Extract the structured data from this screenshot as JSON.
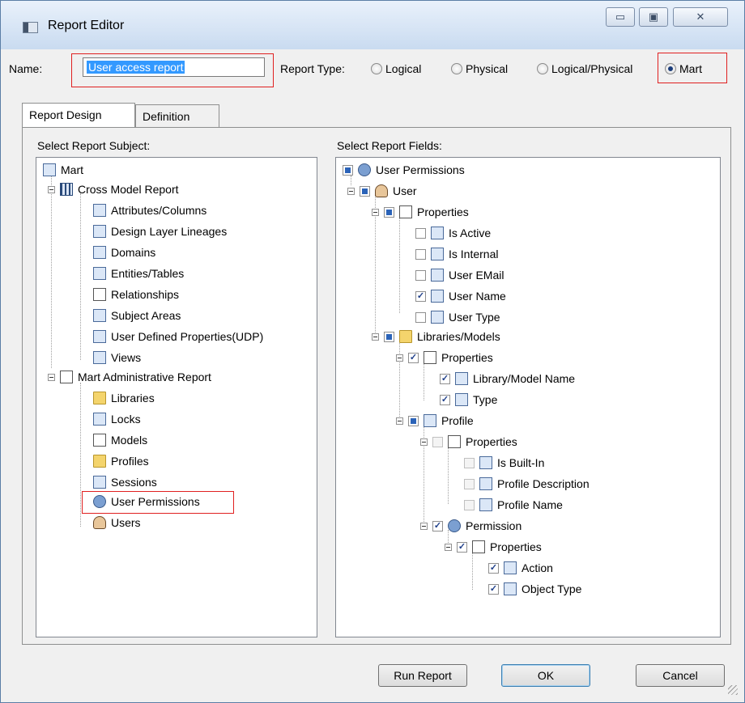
{
  "window": {
    "title": "Report Editor",
    "minimize_label": "▭",
    "maximize_label": "▣",
    "close_label": "✕"
  },
  "name_field": {
    "label": "Name:",
    "value": "User access report"
  },
  "report_type": {
    "label": "Report Type:",
    "options": [
      {
        "label": "Logical",
        "selected": false
      },
      {
        "label": "Physical",
        "selected": false
      },
      {
        "label": "Logical/Physical",
        "selected": false
      },
      {
        "label": "Mart",
        "selected": true
      }
    ]
  },
  "tabs": [
    {
      "label": "Report Design",
      "active": true
    },
    {
      "label": "Definition",
      "active": false
    }
  ],
  "left_pane": {
    "title": "Select Report Subject:",
    "items": [
      {
        "label": "Mart",
        "icon": "building-icon"
      },
      {
        "label": "Cross Model Report",
        "icon": "grid-star-icon"
      },
      {
        "label": "Attributes/Columns",
        "icon": "list-icon"
      },
      {
        "label": "Design Layer Lineages",
        "icon": "lineage-icon"
      },
      {
        "label": "Domains",
        "icon": "domain-icon"
      },
      {
        "label": "Entities/Tables",
        "icon": "table-icon"
      },
      {
        "label": "Relationships",
        "icon": "relationship-icon"
      },
      {
        "label": "Subject Areas",
        "icon": "subject-area-icon"
      },
      {
        "label": "User Defined Properties(UDP)",
        "icon": "udp-icon"
      },
      {
        "label": "Views",
        "icon": "view-icon"
      },
      {
        "label": "Mart Administrative Report",
        "icon": "document-star-icon"
      },
      {
        "label": "Libraries",
        "icon": "folder-icon"
      },
      {
        "label": "Locks",
        "icon": "lock-icon"
      },
      {
        "label": "Models",
        "icon": "document-icon"
      },
      {
        "label": "Profiles",
        "icon": "profiles-icon"
      },
      {
        "label": "Sessions",
        "icon": "sessions-icon"
      },
      {
        "label": "User Permissions",
        "icon": "user-key-icon"
      },
      {
        "label": "Users",
        "icon": "user-icon"
      }
    ]
  },
  "right_pane": {
    "title": "Select Report Fields:",
    "items": [
      {
        "label": "User Permissions",
        "state": "partial"
      },
      {
        "label": "User",
        "state": "partial"
      },
      {
        "label": "Properties",
        "state": "partial"
      },
      {
        "label": "Is Active",
        "state": "unchecked"
      },
      {
        "label": "Is Internal",
        "state": "unchecked"
      },
      {
        "label": "User EMail",
        "state": "unchecked"
      },
      {
        "label": "User Name",
        "state": "checked"
      },
      {
        "label": "User Type",
        "state": "unchecked"
      },
      {
        "label": "Libraries/Models",
        "state": "partial"
      },
      {
        "label": "Properties",
        "state": "checked"
      },
      {
        "label": "Library/Model Name",
        "state": "checked"
      },
      {
        "label": "Type",
        "state": "checked"
      },
      {
        "label": "Profile",
        "state": "partial"
      },
      {
        "label": "Properties",
        "state": "unchecked"
      },
      {
        "label": "Is Built-In",
        "state": "unchecked"
      },
      {
        "label": "Profile Description",
        "state": "unchecked"
      },
      {
        "label": "Profile Name",
        "state": "unchecked"
      },
      {
        "label": "Permission",
        "state": "checked"
      },
      {
        "label": "Properties",
        "state": "checked"
      },
      {
        "label": "Action",
        "state": "checked"
      },
      {
        "label": "Object Type",
        "state": "checked"
      }
    ]
  },
  "buttons": {
    "run_report": "Run Report",
    "ok": "OK",
    "cancel": "Cancel"
  }
}
